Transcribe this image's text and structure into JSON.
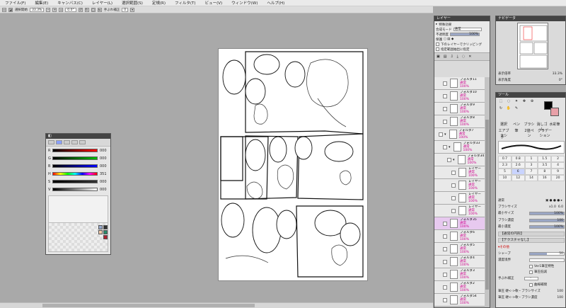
{
  "menu": [
    "ファイル(F)",
    "編集(E)",
    "キャンバス(C)",
    "レイヤー(L)",
    "選択範囲(S)",
    "定規(R)",
    "フィルタ(T)",
    "ビュー(V)",
    "ウィンドウ(W)",
    "ヘルプ(H)"
  ],
  "toolbar": {
    "select_label": "選択開始",
    "zoom": "33.3%",
    "angle": "0.0°",
    "stabilizer_label": "手ぶれ補正",
    "stabilizer_value": "0"
  },
  "color_panel": {
    "sliders": [
      {
        "label": "R",
        "value": "000"
      },
      {
        "label": "G",
        "value": "000"
      },
      {
        "label": "B",
        "value": "000"
      },
      {
        "label": "H",
        "value": "351"
      },
      {
        "label": "S",
        "value": "000"
      },
      {
        "label": "V",
        "value": "000"
      }
    ],
    "colors": {
      "accent": "#8aa0ff",
      "swatch_fg": "#000000",
      "swatch_bg": "#e8a0a8"
    }
  },
  "layer_panel": {
    "title": "レイヤー",
    "effects_label": "特殊効果",
    "blend_label": "合成モード",
    "blend_value": "通常",
    "opacity_label": "不透明度",
    "opacity_value": "100%",
    "protect_label": "保護",
    "clip_label": "下のレイヤーでクリッピング",
    "ref_label": "指定範囲抽出に指定",
    "layers": [
      {
        "name": "フォルダ11",
        "mode": "通常",
        "opacity": "100%",
        "indent": 1,
        "folder": false
      },
      {
        "name": "フォルダ10",
        "mode": "通常",
        "opacity": "100%",
        "indent": 1,
        "folder": false
      },
      {
        "name": "フォルダ9",
        "mode": "通常",
        "opacity": "100%",
        "indent": 1,
        "folder": false
      },
      {
        "name": "フォルダ8",
        "mode": "通常",
        "opacity": "100%",
        "indent": 1,
        "folder": false
      },
      {
        "name": "フォルダ7",
        "mode": "通常",
        "opacity": "100%",
        "indent": 0,
        "folder": true
      },
      {
        "name": "フォルダ33",
        "mode": "通常",
        "opacity": "100%",
        "indent": 1,
        "folder": true
      },
      {
        "name": "フォルダ34",
        "mode": "通常",
        "opacity": "100%",
        "indent": 2,
        "folder": true
      },
      {
        "name": "レイヤー",
        "mode": "通常",
        "opacity": "100%",
        "indent": 3,
        "folder": false
      },
      {
        "name": "レイヤー",
        "mode": "通常",
        "opacity": "100%",
        "indent": 3,
        "folder": false
      },
      {
        "name": "レイヤー",
        "mode": "通常",
        "opacity": "100%",
        "indent": 3,
        "folder": false
      },
      {
        "name": "レイヤー",
        "mode": "通常",
        "opacity": "100%",
        "indent": 3,
        "folder": false
      },
      {
        "name": "フォルダ35",
        "mode": "通常",
        "opacity": "100%",
        "indent": 1,
        "folder": false,
        "selected": true
      },
      {
        "name": "フォルダ6",
        "mode": "通常",
        "opacity": "100%",
        "indent": 1,
        "folder": false
      },
      {
        "name": "フォルダ5",
        "mode": "通常",
        "opacity": "100%",
        "indent": 1,
        "folder": false
      },
      {
        "name": "フォルダ4",
        "mode": "通常",
        "opacity": "100%",
        "indent": 1,
        "folder": false
      },
      {
        "name": "フォルダ3",
        "mode": "通常",
        "opacity": "100%",
        "indent": 1,
        "folder": false
      },
      {
        "name": "フォルダ2",
        "mode": "通常",
        "opacity": "100%",
        "indent": 1,
        "folder": false
      },
      {
        "name": "フォルダ54",
        "mode": "通常",
        "opacity": "100%",
        "indent": 1,
        "folder": false
      }
    ]
  },
  "navigator": {
    "title": "ナビゲータ",
    "zoom_label": "表示倍率",
    "zoom_value": "33.3%",
    "angle_label": "表示角度",
    "angle_value": "0°"
  },
  "tool_panel": {
    "title": "ツール",
    "tools": [
      "選択",
      "ペン",
      "ブラシ",
      "消しゴム",
      "水彩筆",
      "エアブラシ",
      "筆",
      "2値ペン",
      "グラデーション",
      "手"
    ],
    "presets": [
      "0.7",
      "0.8",
      "1",
      "1.5",
      "2",
      "2.3",
      "2.6",
      "3",
      "3.5",
      "4",
      "5",
      "6",
      "7",
      "8",
      "9",
      "10",
      "12",
      "14",
      "16",
      "20"
    ],
    "active_preset": "6",
    "mode_label": "通常",
    "brush_size_label": "ブラシサイズ",
    "brush_size_mult": "x1.0",
    "brush_size_value": "6.0",
    "min_size_label": "最小サイズ",
    "min_size_value": "100%",
    "brush_density_label": "ブラシ濃度",
    "brush_density_value": "100",
    "min_density_label": "最小濃度",
    "min_density_value": "100%",
    "section_normal": "【通常の円形】",
    "section_texture": "【テクスチャなし】",
    "advanced_label": "その他",
    "sharp_label": "シャープ",
    "sharp_value": "50",
    "density_trim_label": "濃度境界",
    "v1_label": "Ver1筆圧特性",
    "reduce_label": "筆圧低減",
    "stab_label": "手ぶれ補正",
    "stab_value": "-",
    "speed_label": "曲線補間",
    "pressure_size_label": "筆圧 硬<->軟・ブラシサイズ",
    "pressure_size_value": "100",
    "pressure_density_label": "筆圧 硬<->軟・ブラシ濃度",
    "pressure_density_value": "100"
  }
}
